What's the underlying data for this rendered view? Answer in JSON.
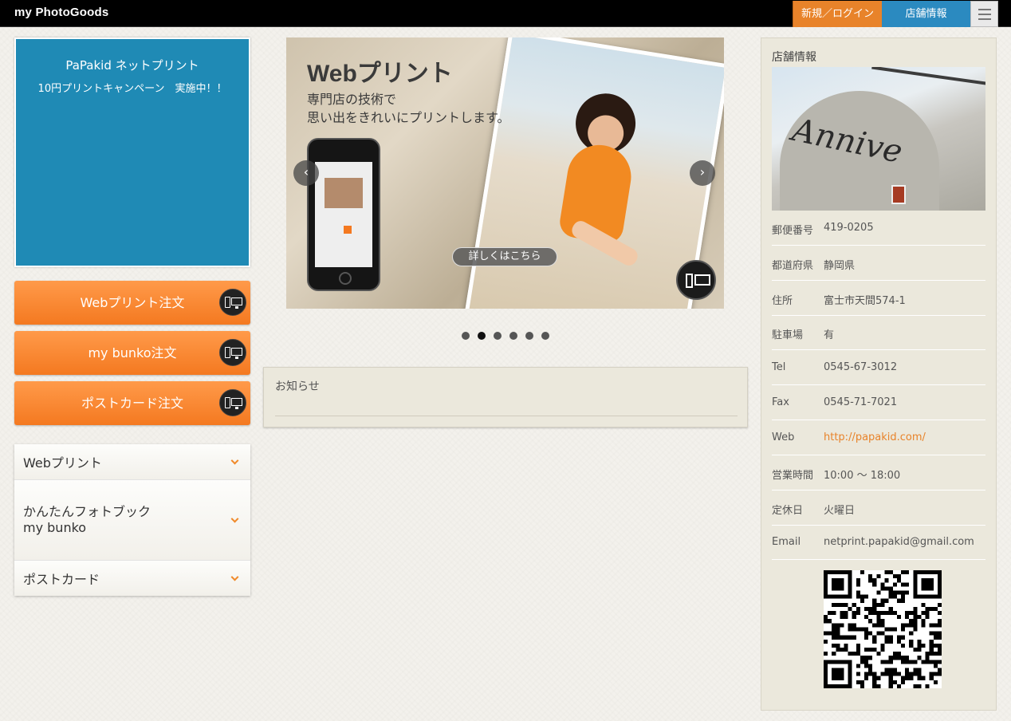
{
  "header": {
    "logo": "my PhotoGoods",
    "login_label": "新規／ログイン",
    "store_label": "店舗情報"
  },
  "campaign": {
    "line1": "PaPakid ネットプリント",
    "line2": "10円プリントキャンペーン　実施中！！",
    "bg_color": "#1f8ab5"
  },
  "order_buttons": [
    {
      "label": "Webプリント注文"
    },
    {
      "label": "my bunko注文"
    },
    {
      "label": "ポストカード注文"
    }
  ],
  "categories": [
    {
      "label": "Webプリント"
    },
    {
      "label": "かんたんフォトブック\nmy bunko"
    },
    {
      "label": "ポストカード"
    }
  ],
  "slider": {
    "title": "Webプリント",
    "sub1": "専門店の技術で",
    "sub2": "思い出をきれいにプリントします。",
    "detail_label": "詳しくはこちら",
    "dot_count": 6,
    "active_dot": 2
  },
  "news": {
    "title": "お知らせ"
  },
  "store": {
    "title": "店舗情報",
    "sign_text": "Annive",
    "rows": [
      {
        "key": "郵便番号",
        "value": "419-0205"
      },
      {
        "key": "都道府県",
        "value": "静岡県"
      },
      {
        "key": "住所",
        "value": "富士市天間574-1"
      },
      {
        "key": "駐車場",
        "value": "有"
      },
      {
        "key": "Tel",
        "value": "0545-67-3012"
      },
      {
        "key": "Fax",
        "value": "0545-71-7021"
      },
      {
        "key": "Web",
        "value": "http://papakid.com/",
        "link": true
      },
      {
        "key": "営業時間",
        "value": "10:00 〜 18:00"
      },
      {
        "key": "定休日",
        "value": "火曜日"
      },
      {
        "key": "Email",
        "value": "netprint.papakid@gmail.com"
      }
    ]
  },
  "colors": {
    "accent_orange": "#f47920",
    "accent_blue": "#2b8ac0"
  }
}
